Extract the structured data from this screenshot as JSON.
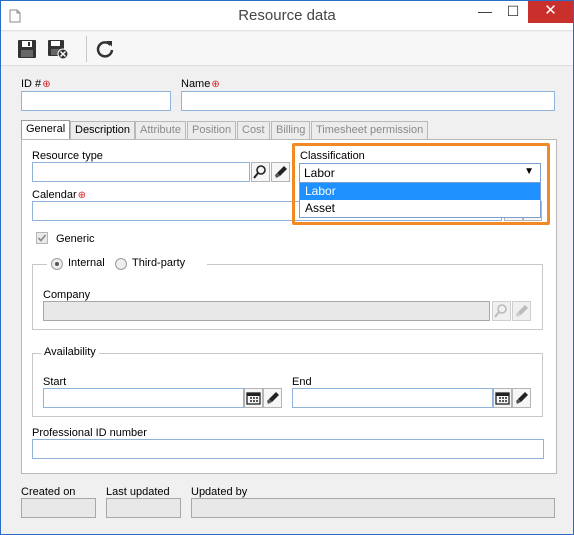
{
  "window": {
    "title": "Resource data",
    "minimize": "—",
    "maximize": "☐",
    "close": "✕"
  },
  "toolbar": {
    "save": "save-icon",
    "save_close": "save-close-icon",
    "refresh": "refresh-icon"
  },
  "header": {
    "id_label": "ID #",
    "name_label": "Name",
    "id_value": "",
    "name_value": ""
  },
  "tabs": [
    {
      "label": "General"
    },
    {
      "label": "Description"
    },
    {
      "label": "Attribute"
    },
    {
      "label": "Position"
    },
    {
      "label": "Cost"
    },
    {
      "label": "Billing"
    },
    {
      "label": "Timesheet permission"
    }
  ],
  "general": {
    "resource_type_label": "Resource type",
    "calendar_label": "Calendar",
    "classification_label": "Classification",
    "classification_value": "Labor",
    "classification_options": [
      "Labor",
      "Asset"
    ],
    "generic_label": "Generic",
    "internal_label": "Internal",
    "third_party_label": "Third-party",
    "company_label": "Company",
    "availability_label": "Availability",
    "start_label": "Start",
    "end_label": "End",
    "professional_id_label": "Professional ID number"
  },
  "footer": {
    "created_label": "Created on",
    "updated_label": "Last updated",
    "updated_by_label": "Updated by"
  },
  "colors": {
    "accent": "#f08a24",
    "close": "#c9302c",
    "selection": "#1e90ff",
    "required": "#d2232a"
  }
}
